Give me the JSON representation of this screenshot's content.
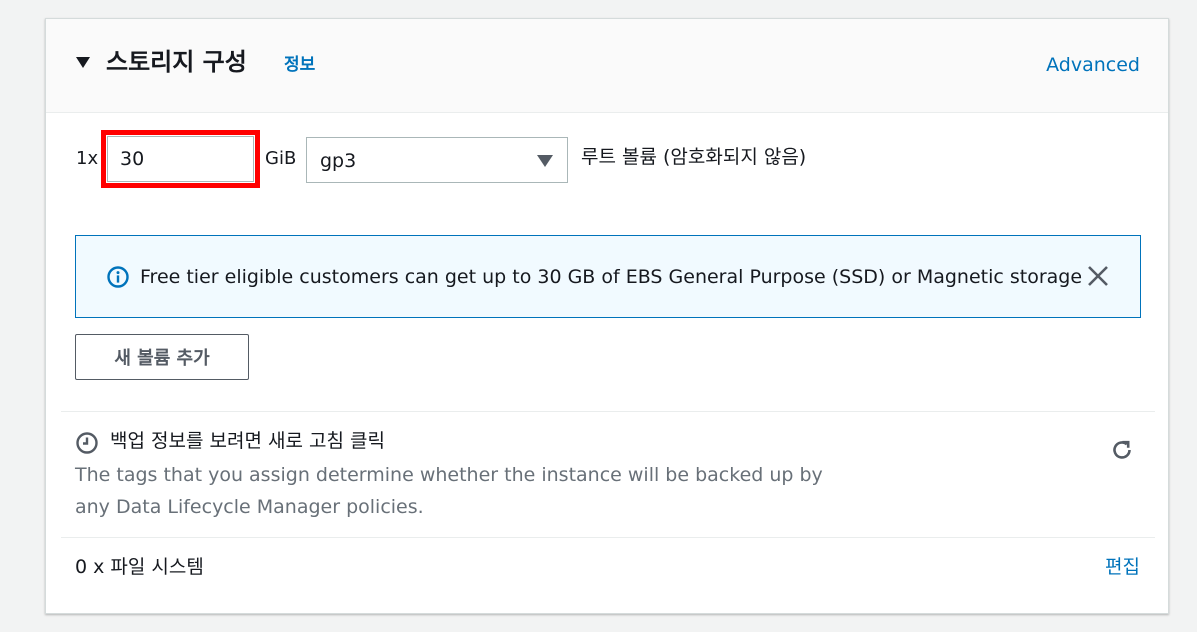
{
  "header": {
    "title": "스토리지 구성",
    "info_link": "정보",
    "advanced_link": "Advanced"
  },
  "root_volume": {
    "multiplier": "1x",
    "size_value": "30",
    "size_unit": "GiB",
    "volume_type": "gp3",
    "description": "루트 볼륨  (암호화되지 않음)"
  },
  "alert": {
    "icon": "info-icon",
    "text": "Free tier eligible customers can get up to 30 GB of EBS General Purpose (SSD) or Magnetic storage",
    "close_icon": "close-icon"
  },
  "add_volume_button": "새 볼륨 추가",
  "backup": {
    "icon": "clock-icon",
    "title": "백업 정보를 보려면 새로 고침 클릭",
    "description": "The tags that you assign determine whether the instance will be backed up by any Data Lifecycle Manager policies.",
    "refresh_icon": "refresh-icon"
  },
  "file_systems": {
    "label": "0 x 파일 시스템",
    "edit_link": "편집"
  },
  "colors": {
    "link": "#0073bb",
    "highlight": "#ff0000",
    "alert_bg": "#f1faff",
    "alert_border": "#0073bb"
  }
}
